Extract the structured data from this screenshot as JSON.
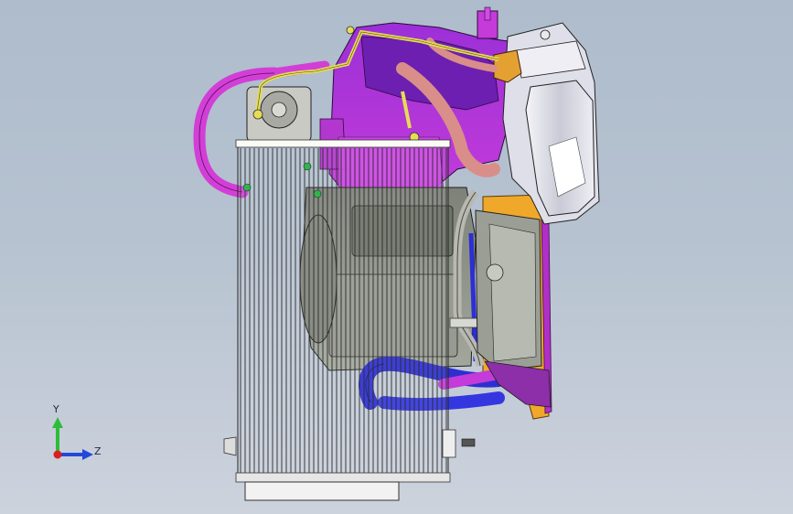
{
  "viewport": {
    "background_top": "#aebccc",
    "background_bottom": "#cdd3dd"
  },
  "model": {
    "parts": [
      {
        "name": "condenser-core",
        "color": "#ffffff"
      },
      {
        "name": "hvac-housing",
        "color": "#c43bd9"
      },
      {
        "name": "blower-housing",
        "color": "#8a8f86"
      },
      {
        "name": "air-duct",
        "color": "#e8e8ef"
      },
      {
        "name": "bracket",
        "color": "#f0a82a"
      },
      {
        "name": "suction-hose",
        "color": "#d23fd6"
      },
      {
        "name": "high-pressure-line",
        "color": "#e6dc55"
      },
      {
        "name": "heater-hose",
        "color": "#2d2fd0"
      },
      {
        "name": "receiver-hose",
        "color": "#d98e8a"
      }
    ]
  },
  "triad": {
    "y_label": "Y",
    "z_label": "Z",
    "y_color": "#2ebd3a",
    "z_color": "#2348d8",
    "x_color": "#d91f1f"
  }
}
